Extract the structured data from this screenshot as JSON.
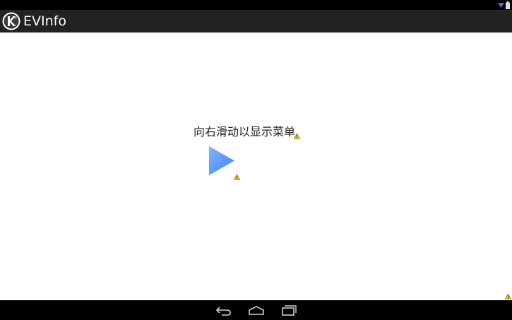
{
  "app": {
    "title": "EVInfo"
  },
  "content": {
    "hint": "向右滑动以显示菜单"
  },
  "icons": {
    "wifi": "wifi-icon",
    "battery": "battery-icon",
    "app": "app-logo-icon",
    "play": "play-arrow-icon",
    "warning": "warning-icon",
    "back": "back-icon",
    "home": "home-icon",
    "recents": "recents-icon"
  },
  "colors": {
    "action_bar": "#222222",
    "status_bar": "#000000",
    "nav_bar": "#000000",
    "accent_blue": "#5a9bff",
    "warning_yellow": "#f5d000"
  }
}
